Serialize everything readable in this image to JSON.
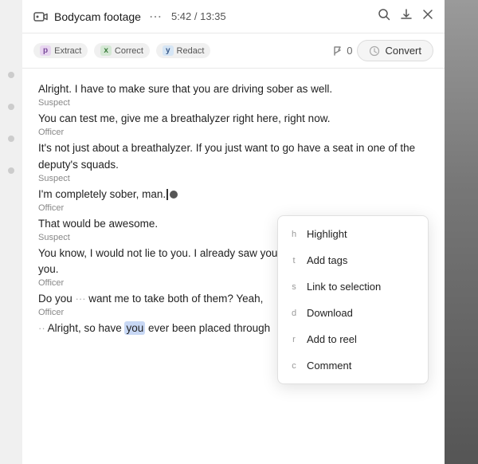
{
  "header": {
    "icon": "👥",
    "title": "Bodycam footage",
    "dots": "⋯",
    "time": "5:42 / 13:35",
    "search_icon": "🔍",
    "download_icon": "⬇",
    "close_icon": "✕"
  },
  "toolbar": {
    "extract_key": "p",
    "extract_label": "Extract",
    "correct_key": "x",
    "correct_label": "Correct",
    "redact_key": "y",
    "redact_label": "Redact",
    "flag_icon": "🚩",
    "flag_count": "0",
    "convert_label": "Convert"
  },
  "transcript": [
    {
      "speaker": "",
      "text": "Alright. I have to make sure that you are driving sober as well."
    },
    {
      "speaker": "Suspect",
      "text": "You can test me, give me a breathalyzer right here, right now."
    },
    {
      "speaker": "Officer",
      "text": "It's not just about a breathalyzer. If you just want to go have a seat in one of the deputy's squads."
    },
    {
      "speaker": "Suspect",
      "text": "I'm completely sober, man."
    },
    {
      "speaker": "Officer",
      "text": "That would be awesome."
    },
    {
      "speaker": "Suspect",
      "text": "You know, I would not lie to you. I already saw you and met you. I would not lie to you."
    },
    {
      "speaker": "Officer",
      "text": "Do you ... want me to take both of them? Yeah,"
    },
    {
      "speaker": "Officer",
      "text": "Alright, so have you ever been placed through"
    }
  ],
  "context_menu": {
    "items": [
      {
        "key": "h",
        "label": "Highlight"
      },
      {
        "key": "t",
        "label": "Add tags"
      },
      {
        "key": "s",
        "label": "Link to selection"
      },
      {
        "key": "d",
        "label": "Download"
      },
      {
        "key": "r",
        "label": "Add to reel"
      },
      {
        "key": "c",
        "label": "Comment"
      }
    ]
  }
}
